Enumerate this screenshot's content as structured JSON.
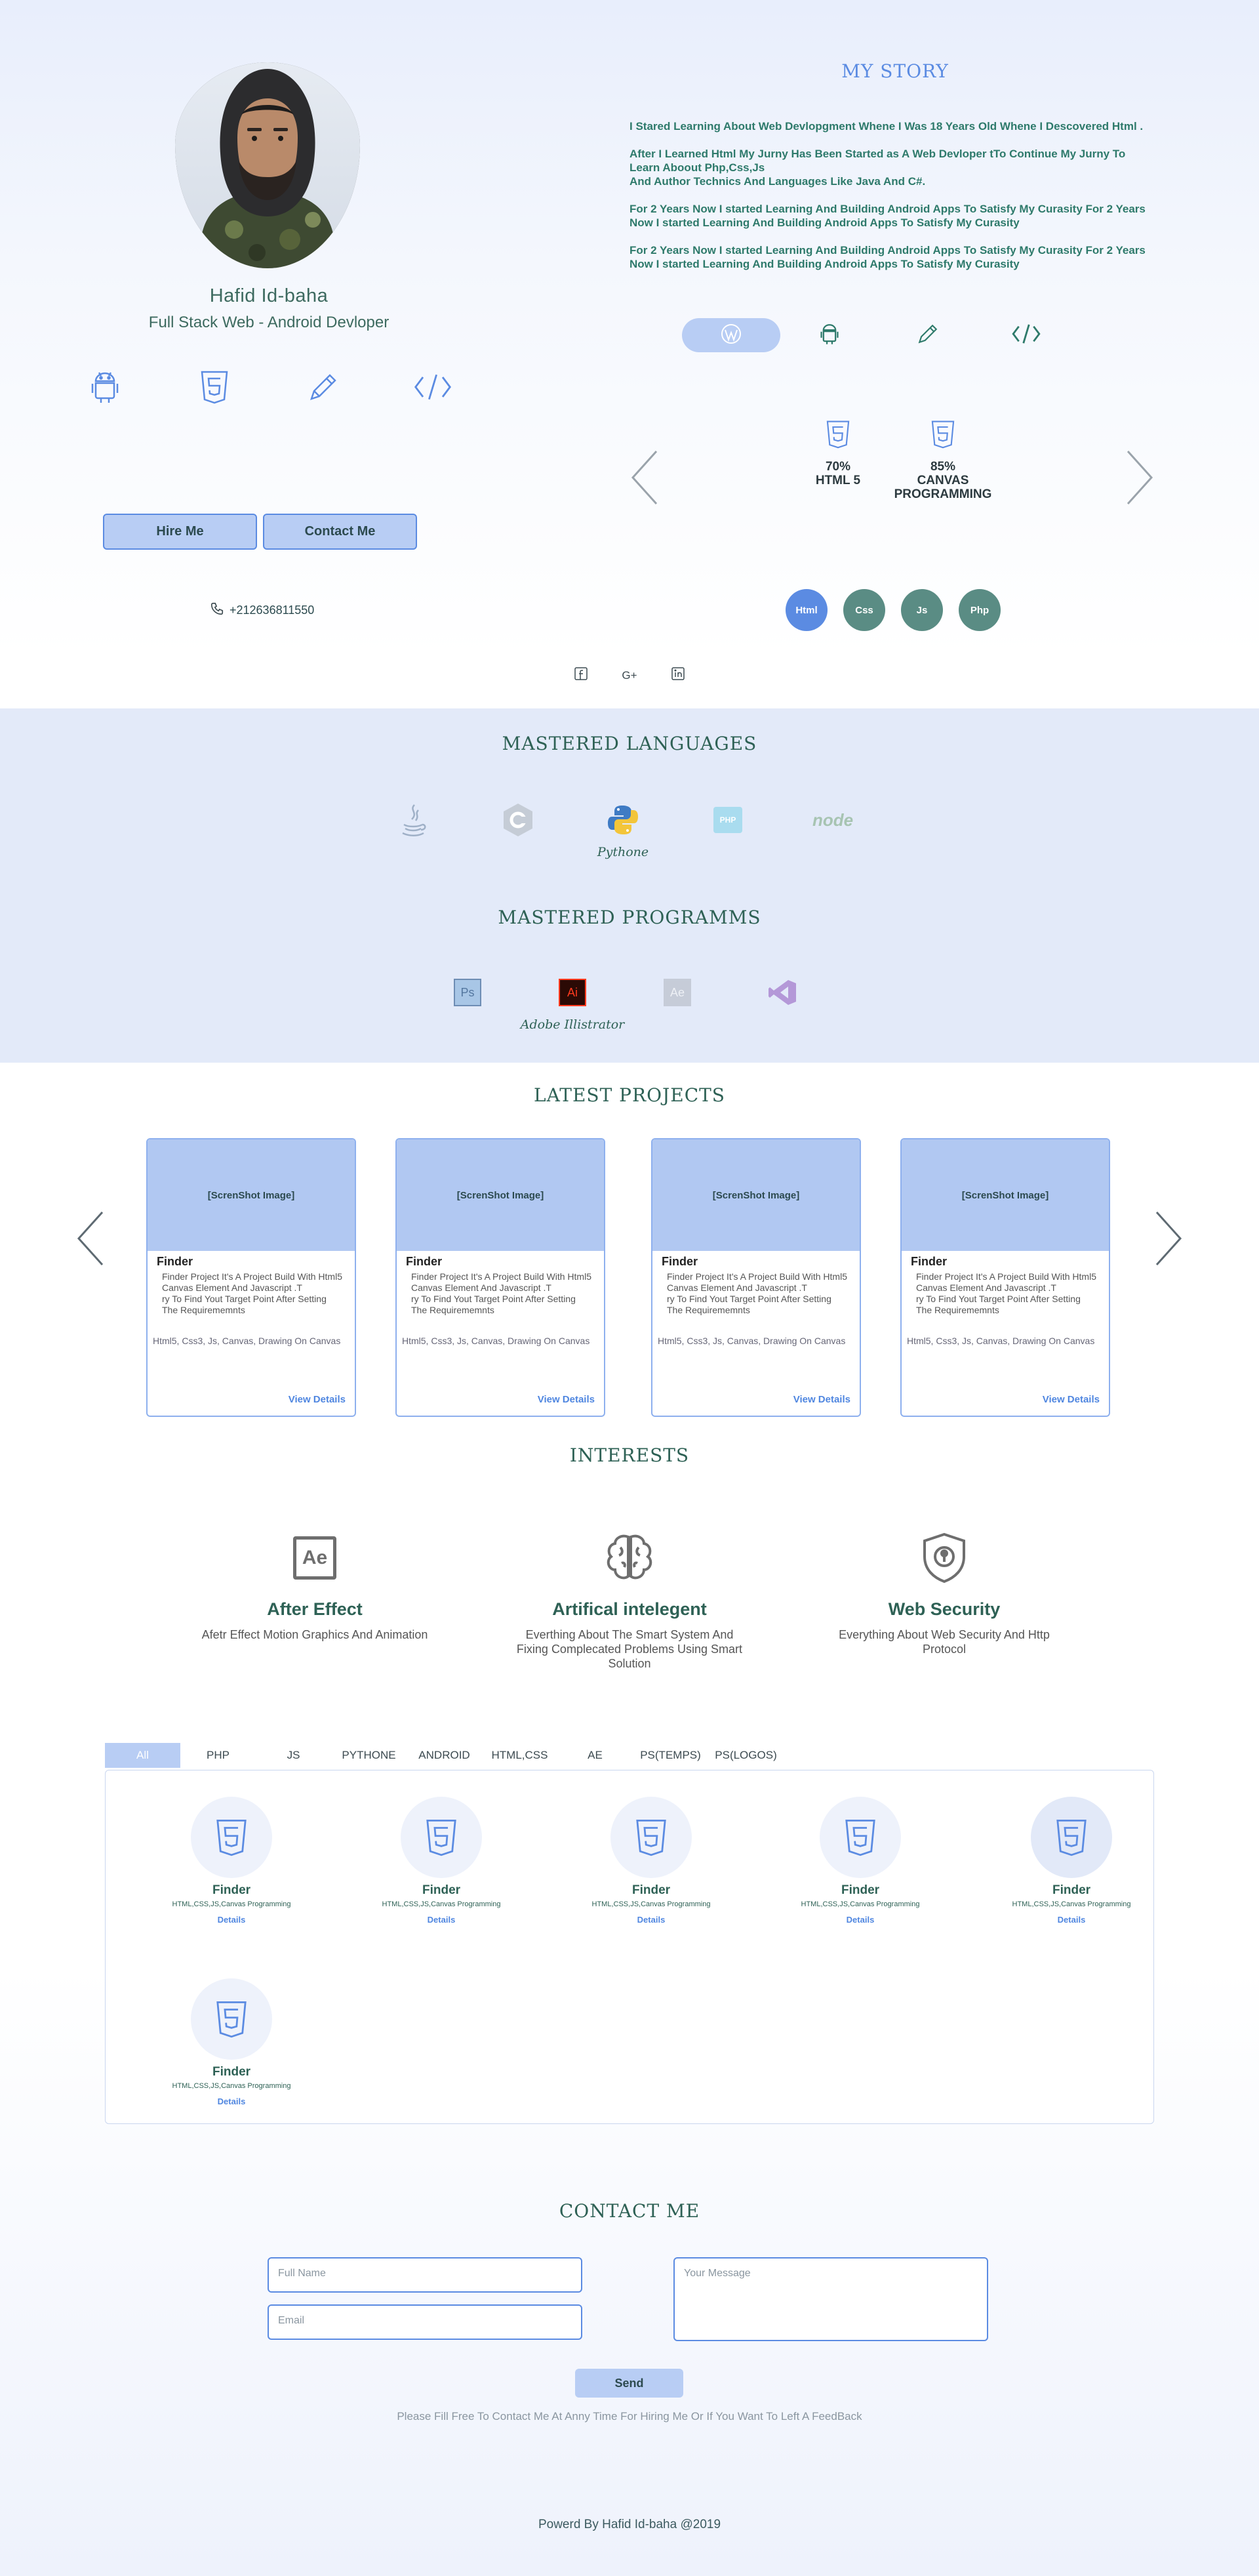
{
  "profile": {
    "name": "Hafid Id-baha",
    "role": "Full Stack Web - Android Devloper",
    "hire_label": "Hire Me",
    "contact_label": "Contact Me",
    "phone": "+212636811550",
    "skill_icons": [
      "android-icon",
      "html5-icon",
      "pencil-icon",
      "code-icon"
    ]
  },
  "story": {
    "title": "MY STORY",
    "paragraphs": [
      "I Stared Learning  About Web Devlopgment Whene I Was 18 Years Old Whene I Descovered Html .",
      "After I Learned Html My Jurny Has Been  Started as A Web Devloper  tTo Continue My Jurny To\nLearn Aboout Php,Css,Js\nAnd Author Technics And Languages Like Java And C#.",
      "For 2 Years Now I started Learning And Building Android Apps To Satisfy My Curasity  For 2 Years\nNow I started Learning And Building Android Apps To Satisfy My Curasity",
      "For 2 Years Now I started Learning And Building Android Apps To Satisfy My Curasity  For 2 Years\nNow I started Learning And Building Android Apps To Satisfy My Curasity"
    ],
    "tabs": [
      "wordpress-icon",
      "android-icon",
      "pencil-icon",
      "code-icon"
    ],
    "active_tab": 0,
    "skills": [
      {
        "percent": "70%",
        "name": "HTML 5"
      },
      {
        "percent": "85%",
        "name": "CANVAS\nPROGRAMMING"
      }
    ],
    "circles": [
      {
        "label": "Html",
        "color": "#5b8be2"
      },
      {
        "label": "Css",
        "color": "#5a8c84"
      },
      {
        "label": "Js",
        "color": "#5a8c84"
      },
      {
        "label": "Php",
        "color": "#5a8c84"
      }
    ]
  },
  "social": [
    "facebook-icon",
    "google-plus-icon",
    "linkedin-icon"
  ],
  "social_gplus": "G+",
  "mastered": {
    "languages_title": "MASTERED LANGUAGES",
    "languages": [
      {
        "icon": "java-icon",
        "caption": ""
      },
      {
        "icon": "csharp-icon",
        "caption": ""
      },
      {
        "icon": "python-icon",
        "caption": "Pythone"
      },
      {
        "icon": "php-icon",
        "caption": "",
        "text": "PHP"
      },
      {
        "icon": "nodejs-icon",
        "caption": "",
        "text": "node"
      }
    ],
    "programs_title": "MASTERED PROGRAMMS",
    "programs": [
      {
        "icon": "photoshop-icon",
        "caption": "",
        "text": "Ps"
      },
      {
        "icon": "illustrator-icon",
        "caption": "Adobe Illistrator",
        "text": "Ai"
      },
      {
        "icon": "after-effects-icon",
        "caption": "",
        "text": "Ae"
      },
      {
        "icon": "visual-studio-icon",
        "caption": ""
      }
    ]
  },
  "projects": {
    "title": "LATEST PROJECTS",
    "items": [
      {
        "shot": "[ScrenShot Image]",
        "title": "Finder",
        "desc": "Finder Project It's A Project Build With Html5\nCanvas Element  And Javascript .T\nry To Find Yout Target Point After Setting\nThe Requirememnts",
        "tech": "Html5, Css3, Js, Canvas, Drawing On Canvas",
        "link": "View Details"
      },
      {
        "shot": "[ScrenShot Image]",
        "title": "Finder",
        "desc": "Finder Project It's A Project Build With Html5\nCanvas Element  And Javascript .T\nry To Find Yout Target Point After Setting\nThe Requirememnts",
        "tech": "Html5, Css3, Js, Canvas, Drawing On Canvas",
        "link": "View Details"
      },
      {
        "shot": "[ScrenShot Image]",
        "title": "Finder",
        "desc": "Finder Project It's A Project Build With Html5\nCanvas Element  And Javascript .T\nry To Find Yout Target Point After Setting\nThe Requirememnts",
        "tech": "Html5, Css3, Js, Canvas, Drawing On Canvas",
        "link": "View Details"
      },
      {
        "shot": "[ScrenShot Image]",
        "title": "Finder",
        "desc": "Finder Project It's A Project Build With Html5\nCanvas Element  And Javascript .T\nry To Find Yout Target Point After Setting\nThe Requirememnts",
        "tech": "Html5, Css3, Js, Canvas, Drawing On Canvas",
        "link": "View Details"
      }
    ]
  },
  "interests": {
    "title": "INTERESTS",
    "items": [
      {
        "icon": "after-effects-icon",
        "title": "After Effect",
        "desc": "Afetr Effect Motion Graphics And Animation",
        "text": "Ae"
      },
      {
        "icon": "brain-icon",
        "title": "Artifical intelegent",
        "desc": "Everthing About The Smart System And Fixing Complecated Problems Using Smart Solution"
      },
      {
        "icon": "shield-icon",
        "title": "Web Security",
        "desc": "Everything About Web Security And Http Protocol"
      }
    ]
  },
  "portfolio": {
    "filters": [
      "All",
      "PHP",
      "JS",
      "PYTHONE",
      "ANDROID",
      "HTML,CSS",
      "AE",
      "PS(TEMPS)",
      "PS(LOGOS)"
    ],
    "active_filter": 0,
    "items": [
      {
        "title": "Finder",
        "sub": "HTML,CSS,JS,Canvas Programming",
        "link": "Details"
      },
      {
        "title": "Finder",
        "sub": "HTML,CSS,JS,Canvas Programming",
        "link": "Details"
      },
      {
        "title": "Finder",
        "sub": "HTML,CSS,JS,Canvas Programming",
        "link": "Details"
      },
      {
        "title": "Finder",
        "sub": "HTML,CSS,JS,Canvas Programming",
        "link": "Details"
      },
      {
        "title": "Finder",
        "sub": "HTML,CSS,JS,Canvas Programming",
        "link": "Details"
      },
      {
        "title": "Finder",
        "sub": "HTML,CSS,JS,Canvas Programming",
        "link": "Details"
      }
    ]
  },
  "contact": {
    "title": "CONTACT ME",
    "fullname_placeholder": "Full Name",
    "email_placeholder": "Email",
    "message_placeholder": "Your Message",
    "send_label": "Send",
    "note": "Please Fill Free To Contact Me At Anny Time For Hiring Me Or If You Want To Left A FeedBack"
  },
  "footer": "Powerd By Hafid Id-baha  @2019",
  "colors": {
    "accent": "#5b8be2",
    "accent_light": "#b8cdf4",
    "teal": "#2e6155",
    "circle_teal": "#5a8c84"
  }
}
